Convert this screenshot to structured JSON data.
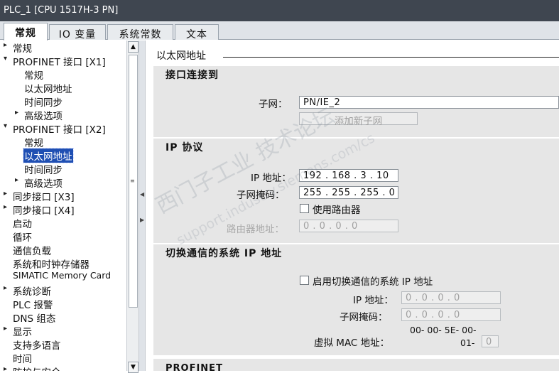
{
  "window": {
    "title": "PLC_1 [CPU 1517H-3 PN]"
  },
  "tabs": [
    "常规",
    "IO 变量",
    "系统常数",
    "文本"
  ],
  "tree": [
    {
      "label": "常规",
      "arrow": "▸"
    },
    {
      "label": "PROFINET 接口 [X1]",
      "arrow": "▾"
    },
    {
      "label": "常规",
      "arrow": ""
    },
    {
      "label": "以太网地址",
      "arrow": ""
    },
    {
      "label": "时间同步",
      "arrow": ""
    },
    {
      "label": "高级选项",
      "arrow": "▸"
    },
    {
      "label": "PROFINET 接口 [X2]",
      "arrow": "▾"
    },
    {
      "label": "常规",
      "arrow": ""
    },
    {
      "label": "以太网地址",
      "arrow": ""
    },
    {
      "label": "时间同步",
      "arrow": ""
    },
    {
      "label": "高级选项",
      "arrow": "▸"
    },
    {
      "label": "同步接口 [X3]",
      "arrow": "▸"
    },
    {
      "label": "同步接口 [X4]",
      "arrow": "▸"
    },
    {
      "label": "启动",
      "arrow": ""
    },
    {
      "label": "循环",
      "arrow": ""
    },
    {
      "label": "通信负载",
      "arrow": ""
    },
    {
      "label": "系统和时钟存储器",
      "arrow": ""
    },
    {
      "label": "SIMATIC Memory Card",
      "arrow": ""
    },
    {
      "label": "系统诊断",
      "arrow": "▸"
    },
    {
      "label": "PLC 报警",
      "arrow": ""
    },
    {
      "label": "DNS 组态",
      "arrow": ""
    },
    {
      "label": "显示",
      "arrow": "▸"
    },
    {
      "label": "支持多语言",
      "arrow": ""
    },
    {
      "label": "时间",
      "arrow": ""
    },
    {
      "label": "防护与安全",
      "arrow": "▸"
    }
  ],
  "content": {
    "heading": "以太网地址",
    "interface": {
      "title": "接口连接到",
      "subnet_label": "子网：",
      "subnet_value": "PN/IE_2",
      "add_subnet_button": "添加新子网"
    },
    "ip": {
      "title": "IP 协议",
      "ip_label": "IP 地址：",
      "ip_value": "192 . 168 . 3   . 10",
      "mask_label": "子网掩码：",
      "mask_value": "255 . 255 . 255 . 0",
      "router_checkbox": "使用路由器",
      "router_label": "路由器地址：",
      "router_value": "0   . 0   . 0   . 0"
    },
    "switch": {
      "title": "切换通信的系统 IP 地址",
      "enable_checkbox": "启用切换通信的系统 IP 地址",
      "ip_label": "IP 地址：",
      "ip_value": "0   . 0   . 0   . 0",
      "mask_label": "子网掩码：",
      "mask_value": "0   . 0   . 0   . 0",
      "mac_label": "虚拟 MAC 地址：",
      "mac_line1": "00- 00- 5E- 00-",
      "mac_line2": "01-",
      "mac_value": "0"
    },
    "profinet": {
      "title": "PROFINET"
    }
  },
  "watermark": {
    "line1": "西门子工业 技术论坛",
    "line2": "support.industry.siemens.com/cs"
  }
}
